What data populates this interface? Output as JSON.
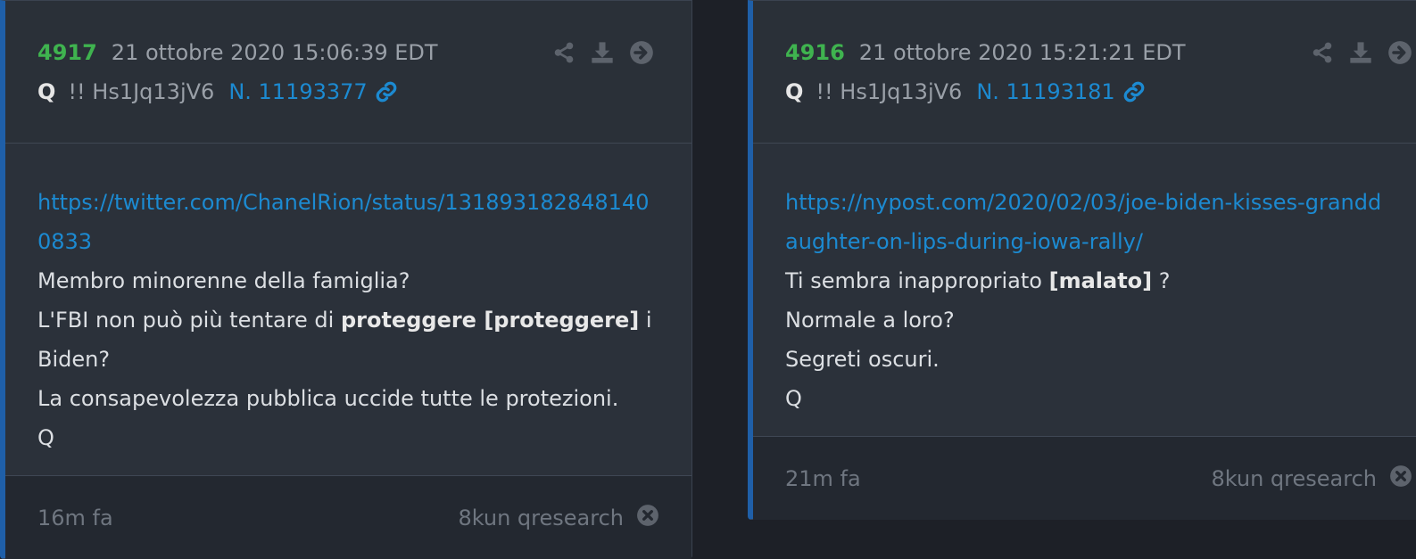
{
  "posts": [
    {
      "number": "4917",
      "date": "21 ottobre 2020 15:06:39 EDT",
      "author": "Q",
      "tripcode": "!! Hs1Jq13jV6",
      "post_no": "N. 11193377",
      "link": "https://twitter.com/ChanelRion/status/1318931828481400833",
      "line1": "Membro minorenne della famiglia?",
      "line2_pre": "L'FBI non può più tentare di ",
      "line2_bold": "proteggere [proteggere]",
      "line2_post": " i Biden?",
      "line3": "La consapevolezza pubblica uccide tutte le protezioni.",
      "line4": "Q",
      "age": "16m fa",
      "source": "8kun qresearch"
    },
    {
      "number": "4916",
      "date": "21 ottobre 2020 15:21:21 EDT",
      "author": "Q",
      "tripcode": "!! Hs1Jq13jV6",
      "post_no": "N. 11193181",
      "link": "https://nypost.com/2020/02/03/joe-biden-kisses-granddaughter-on-lips-during-iowa-rally/",
      "line1_pre": "Ti sembra inappropriato ",
      "line1_bold": "[malato]",
      "line1_post": " ?",
      "line2": "Normale a loro?",
      "line3": "Segreti oscuri.",
      "line4": "Q",
      "age": "21m fa",
      "source": "8kun qresearch"
    }
  ],
  "icons": [
    "share-icon",
    "download-icon",
    "arrow-right-circle-icon",
    "link-icon",
    "close-circle-icon"
  ],
  "colors": {
    "number": "#3fb34f",
    "link": "#1c8ad1",
    "accent_border": "#1f5fa8"
  }
}
